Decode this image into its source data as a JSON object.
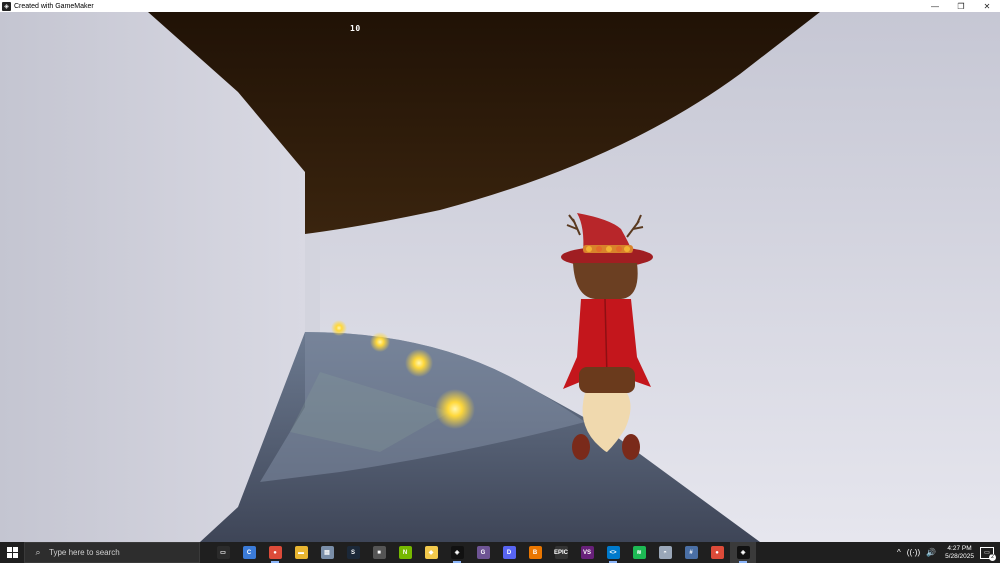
{
  "window": {
    "title": "Created with GameMaker",
    "controls": {
      "minimize": "—",
      "restore": "❐",
      "close": "✕"
    }
  },
  "hud": {
    "score": "10"
  },
  "scene": {
    "character": "witch-with-red-hat",
    "orbs": 4,
    "colors": {
      "sky": "#dcdce6",
      "ceiling": "#2c1b0c",
      "floor": "#4a5466",
      "wall": "#c9cad6",
      "orb": "#ffd840",
      "hat": "#b8262a",
      "coat": "#c4161c"
    }
  },
  "taskbar": {
    "search_placeholder": "Type here to search",
    "apps": [
      {
        "name": "task-view",
        "color": "#2b2b2b",
        "glyph": "▭"
      },
      {
        "name": "copilot",
        "color": "#3b7bd8",
        "glyph": "C"
      },
      {
        "name": "chrome",
        "color": "#dd4b39",
        "glyph": "●"
      },
      {
        "name": "file-explorer",
        "color": "#e8b531",
        "glyph": "▬"
      },
      {
        "name": "app-5",
        "color": "#7a8ea8",
        "glyph": "▤"
      },
      {
        "name": "steam",
        "color": "#1b2838",
        "glyph": "S"
      },
      {
        "name": "app-7",
        "color": "#555555",
        "glyph": "■"
      },
      {
        "name": "nvidia",
        "color": "#76b900",
        "glyph": "N"
      },
      {
        "name": "app-9",
        "color": "#f2c94c",
        "glyph": "◆"
      },
      {
        "name": "gamemaker",
        "color": "#111111",
        "glyph": "◈"
      },
      {
        "name": "github-desktop",
        "color": "#6e5494",
        "glyph": "G"
      },
      {
        "name": "discord",
        "color": "#5865f2",
        "glyph": "D"
      },
      {
        "name": "blender",
        "color": "#ea7600",
        "glyph": "B"
      },
      {
        "name": "epic-games",
        "color": "#333333",
        "glyph": "EPIC"
      },
      {
        "name": "visual-studio",
        "color": "#68217a",
        "glyph": "VS"
      },
      {
        "name": "vs-code",
        "color": "#007acc",
        "glyph": "<>"
      },
      {
        "name": "spotify",
        "color": "#1db954",
        "glyph": "≋"
      },
      {
        "name": "app-18",
        "color": "#9aa7b8",
        "glyph": "◓"
      },
      {
        "name": "calculator",
        "color": "#4a6fa5",
        "glyph": "#"
      },
      {
        "name": "chrome-profile",
        "color": "#dd4b39",
        "glyph": "●"
      },
      {
        "name": "gamemaker-runner",
        "color": "#111111",
        "glyph": "◈"
      }
    ],
    "tray": {
      "chevron": "^",
      "network": "((·))",
      "volume": "🔊"
    },
    "clock": {
      "time": "4:27 PM",
      "date": "5/28/2025"
    },
    "notifications": "2"
  }
}
